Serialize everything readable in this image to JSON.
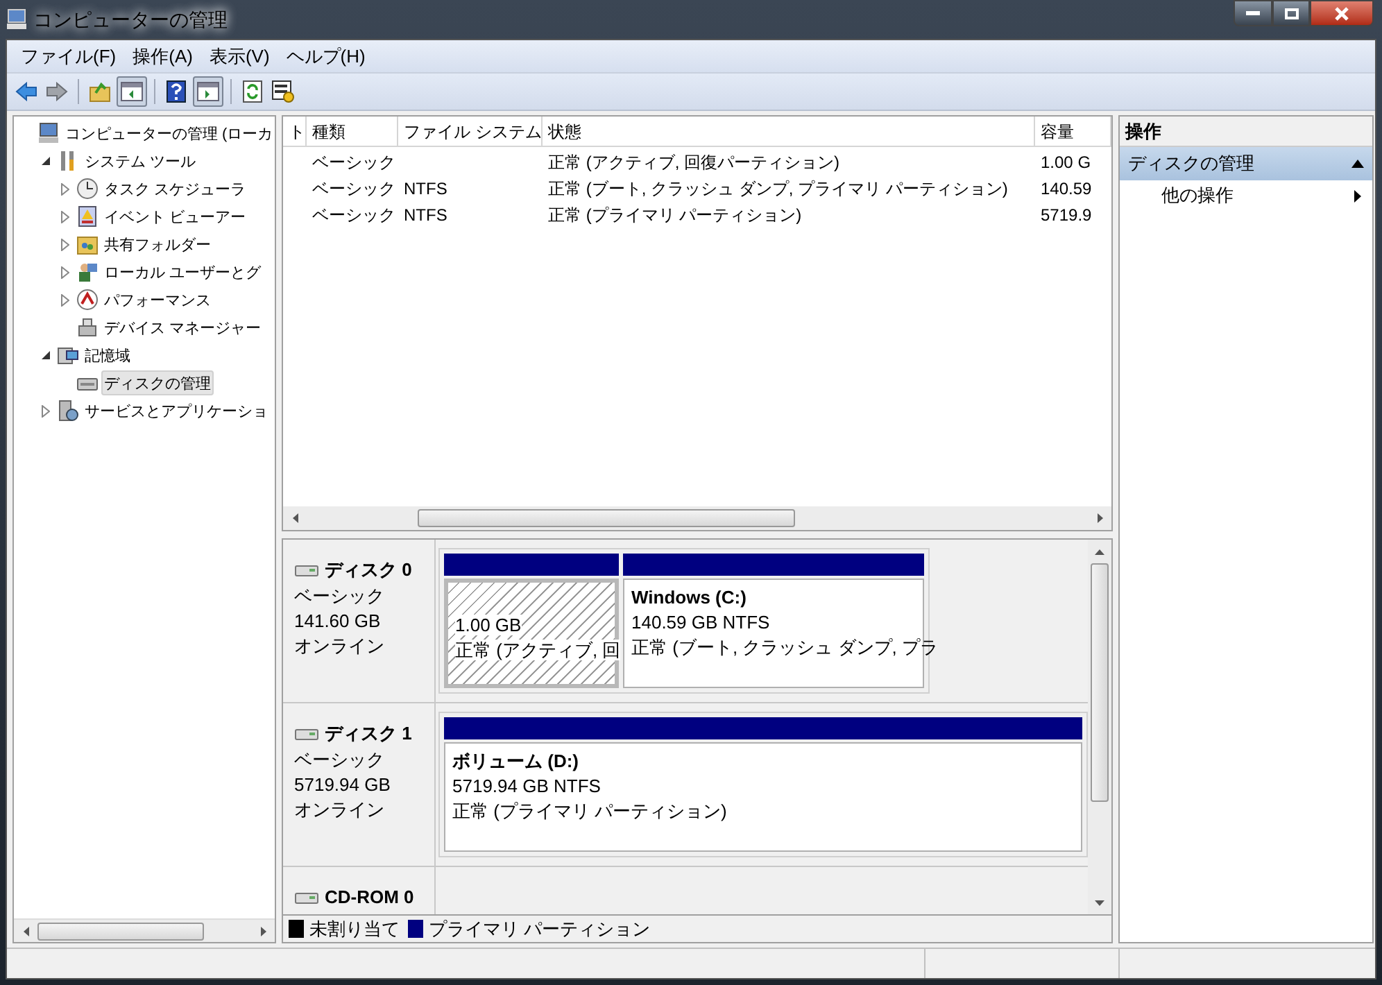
{
  "window": {
    "title": "コンピューターの管理"
  },
  "menu": [
    "ファイル(F)",
    "操作(A)",
    "表示(V)",
    "ヘルプ(H)"
  ],
  "tree": [
    {
      "label": "コンピューターの管理 (ローカ",
      "selected": false,
      "children": [
        {
          "label": "システム ツール",
          "expanded": true,
          "selected": false,
          "children": [
            {
              "label": "タスク スケジューラ",
              "expanded": false,
              "selected": false
            },
            {
              "label": "イベント ビューアー",
              "expanded": false,
              "selected": false
            },
            {
              "label": "共有フォルダー",
              "expanded": false,
              "selected": false
            },
            {
              "label": "ローカル ユーザーとグ",
              "expanded": false,
              "selected": false
            },
            {
              "label": "パフォーマンス",
              "expanded": false,
              "selected": false
            },
            {
              "label": "デバイス マネージャー",
              "selected": false
            }
          ]
        },
        {
          "label": "記憶域",
          "expanded": true,
          "selected": false,
          "children": [
            {
              "label": "ディスクの管理",
              "selected": true
            }
          ]
        },
        {
          "label": "サービスとアプリケーショ",
          "expanded": false,
          "selected": false
        }
      ]
    }
  ],
  "volume_list": {
    "columns": [
      "ト",
      "種類",
      "ファイル システム",
      "状態",
      "容量"
    ],
    "rows": [
      [
        "",
        "ベーシック",
        "",
        "正常 (アクティブ, 回復パーティション)",
        "1.00 G"
      ],
      [
        "",
        "ベーシック",
        "NTFS",
        "正常 (ブート, クラッシュ ダンプ, プライマリ パーティション)",
        "140.59"
      ],
      [
        "",
        "ベーシック",
        "NTFS",
        "正常 (プライマリ パーティション)",
        "5719.9"
      ]
    ]
  },
  "disks": [
    {
      "name": "ディスク 0",
      "type": "ベーシック",
      "size": "141.60 GB",
      "status": "オンライン",
      "partitions": [
        {
          "size": "1.00 GB",
          "status": "正常 (アクティブ, 回",
          "selected": true
        },
        {
          "title": "Windows  (C:)",
          "size": "140.59 GB NTFS",
          "status": "正常 (ブート, クラッシュ ダンプ, プラ",
          "selected": false
        }
      ]
    },
    {
      "name": "ディスク 1",
      "type": "ベーシック",
      "size": "5719.94 GB",
      "status": "オンライン",
      "partitions": [
        {
          "title": "ボリューム  (D:)",
          "size": "5719.94 GB NTFS",
          "status": "正常 (プライマリ パーティション)",
          "selected": false
        }
      ]
    },
    {
      "name": "CD-ROM 0"
    }
  ],
  "legend": [
    {
      "label": "未割り当て",
      "color": "#000000"
    },
    {
      "label": "プライマリ パーティション",
      "color": "#000080"
    }
  ],
  "actions": {
    "header": "操作",
    "section": {
      "label": "ディスクの管理",
      "expanded": true
    },
    "items": [
      "他の操作"
    ]
  }
}
